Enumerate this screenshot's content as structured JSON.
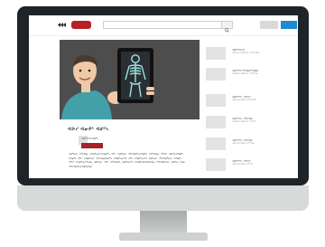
{
  "header": {
    "logo_text": "",
    "search_placeholder": ""
  },
  "video": {
    "title": "ᐊᐅᓯ ᐊᓂᑭᔅ ᐊᑯᑦᓴ",
    "channel_name": "ᐊᑯᑦᓴᔭᐅᑎᑯᑦᓴ",
    "description": "ᐊᑯᑦᓴᔭᐅ ᐊᑦᐅᐱᑲᓴ ᐅᑎᑯᑦᓴᔭᐅᑦᓴᐱᑲᓯᑦᓴ ᐊᑦᐅ ᐊᑯᑦᓴᔭᐅ ᐊᑦᐅᑎᑯᑦᓴᔭᐅᑎᑯᑦᓴ ᐅᑎᑦᓴᐱᑲᓴ ᐊᑦᐅᑎ ᐊᑯᑦᓴᔭᐅᑎᑯᑦᓴ ᐅᑎᑯᑦᓴ ᐊᑦᐅ ᐅᑎᑯᑦᓴᔭᐅ ᐊᑦᐅᐱᑲᓴᐱᑲᓯᑦᓴ ᐅᑎᑯᑦᓴᔭᐅᑦᓴ ᐊᑦᐅ ᐅᑎᑯᑦᓴᔭᐅᑎ ᐊᑯᑦᓴᔭᐅ ᐊᑦᐅᑎᑯᑦᓴᔭᐅ ᐅᑎᑯᑦᓴ ᐊᑦᐅᑦ ᐅᑎᑯᑦᓴᔭᐅᑦᓴᐱᑲ ᐊᑯᑦᓴᔭᐅ ᐊᑦᐅ ᐊᑦᐅᑎᑯᑦᓴ ᐊᑯᑦᓴᔭᐅᑦᓴ ᐅᑎᑯᑦᓴᔭᐅᑎᑯᑦᓴᐱᑲ ᐊᑦᐅᑎᑯᑦᓴᔭᐅ ᐊᑯᑦᓴᔭ ᐅᑎᑯ ᐊᑦᐅᑎᑯᑦᓴᔭᐅᑎᑯᑦᓴᐱᑲᓯ"
  },
  "sidebar": {
    "items": [
      {
        "title": "ᐊᑯᑦᓴᔭᐅᑎ",
        "subtitle": "ᐊᑯᑦᓴᔭᐅᑎᑯᑦᓴᔭᐅ ᐊᑦᐅᑎᑯᑦᓴ"
      },
      {
        "title": "ᐊᑯᑦᓴᔭᐅᑦᓴᐱᑲᓯᑦᓴᐱᑲᓯ",
        "subtitle": "ᐊᑯᑦᓴᔭᐅᑎᑯᑦᓴᔭᐅ ᐊᑦᐅᑎᑯ"
      },
      {
        "title": "ᐊᑯᑦᓴᔭᐅ ᐊᑦᐅᑎ",
        "subtitle": "ᐊᑯᑦᓴᔭᐅᑎᑯᑦᓴ ᐊᑦᐅᑎᑯᑦᓴ"
      },
      {
        "title": "ᐊᑯᑦᓴᔭᐅ ᐊᑦᐅᑎᑯ",
        "subtitle": "ᐊᑯᑦᓴᔭᐅᑎᑯᑦᓴᔭᐅ ᐊᑦᐅᑎ"
      },
      {
        "title": "ᐊᑯᑦᓴᔭᐅ ᐊᑦᐅᑎᑯ",
        "subtitle": "ᐊᑯᑦᓴᔭᐅᑎᑯᑦᓴ ᐊᑦᐅᑎᑯ"
      },
      {
        "title": "ᐊᑯᑦᓴᔭᐅ ᐊᑦᐅᑎ",
        "subtitle": "ᐊᑯᑦᓴᔭᐅᑎᑯᑦᓴ ᐊᑦᐅᑎ"
      }
    ]
  },
  "colors": {
    "brand_red": "#b91f27",
    "subscribe_red": "#a4232a",
    "header_blue": "#1e8bd0",
    "player_bg": "#4d4d4d",
    "monitor_bezel": "#1f2428"
  },
  "icons": {
    "logo": "video-logo-icon",
    "search": "magnifier-icon"
  }
}
